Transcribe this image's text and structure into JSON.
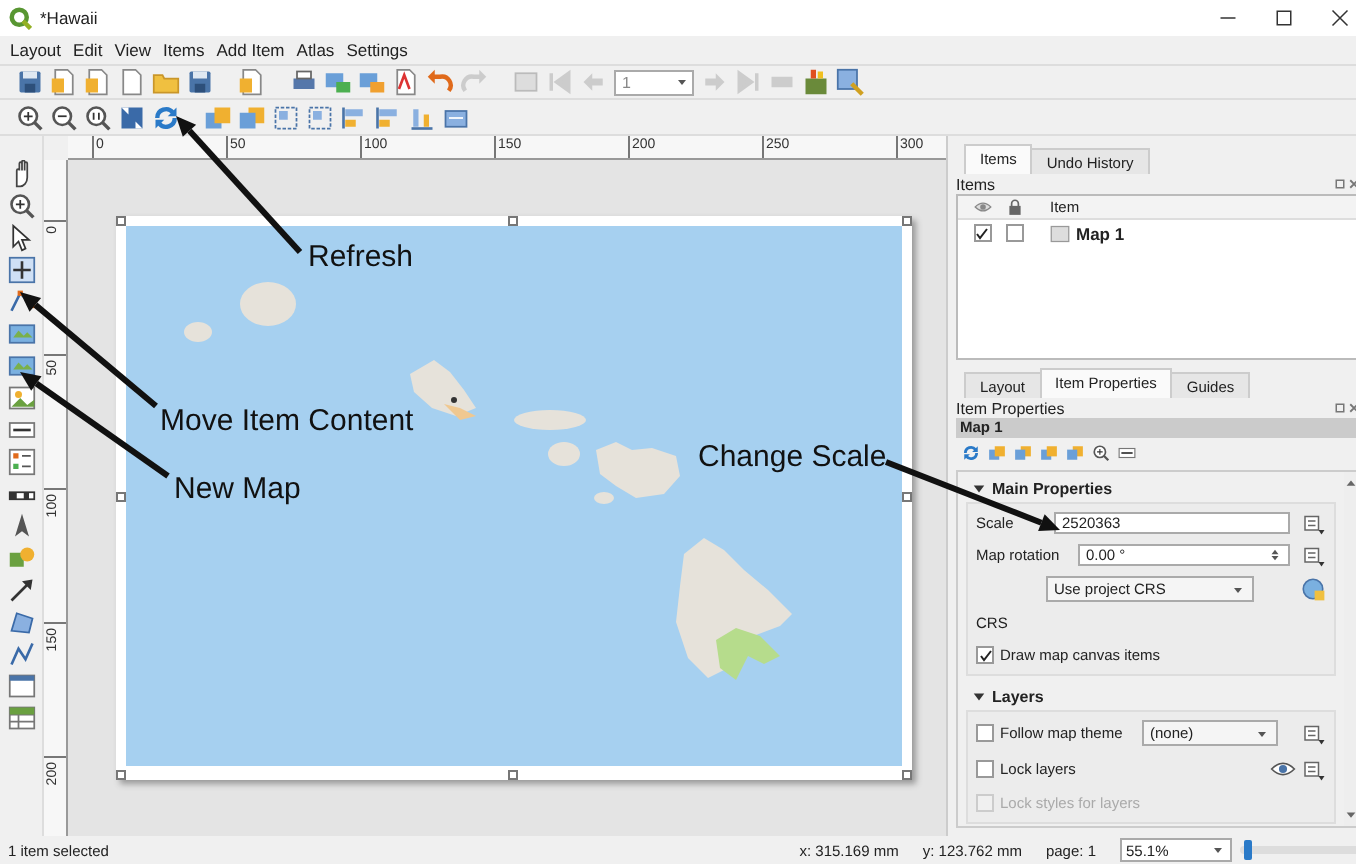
{
  "window": {
    "title": "*Hawaii"
  },
  "menu": [
    {
      "label": "Layout"
    },
    {
      "label": "Edit"
    },
    {
      "label": "View"
    },
    {
      "label": "Items"
    },
    {
      "label": "Add Item"
    },
    {
      "label": "Atlas"
    },
    {
      "label": "Settings"
    }
  ],
  "toolbar": {
    "page_field": "1"
  },
  "rulers": {
    "horizontal": [
      "0",
      "50",
      "100",
      "150",
      "200",
      "250",
      "300"
    ],
    "vertical": [
      "0",
      "50",
      "100",
      "150",
      "200"
    ]
  },
  "annotations": [
    {
      "text": "Refresh"
    },
    {
      "text": "Move Item Content"
    },
    {
      "text": "New Map"
    },
    {
      "text": "Change Scale"
    }
  ],
  "items_panel": {
    "tabs": [
      {
        "label": "Items",
        "selected": true
      },
      {
        "label": "Undo History",
        "selected": false
      }
    ],
    "title": "Items",
    "column": "Item",
    "items": [
      {
        "name": "Map 1",
        "visible": true,
        "locked": false
      }
    ]
  },
  "properties_panel": {
    "tabs": [
      {
        "label": "Layout",
        "selected": false
      },
      {
        "label": "Item Properties",
        "selected": true
      },
      {
        "label": "Guides",
        "selected": false
      }
    ],
    "title": "Item Properties",
    "item": "Map 1",
    "main": {
      "title": "Main Properties",
      "expanded": true,
      "scale_label": "Scale",
      "scale": "2520363",
      "rotation_label": "Map rotation",
      "rotation": "0.00 °",
      "crs_select": "Use project CRS",
      "crs_label": "CRS",
      "draw_canvas_items": {
        "label": "Draw map canvas items",
        "checked": true
      }
    },
    "layers": {
      "title": "Layers",
      "expanded": true,
      "follow_theme": {
        "label": "Follow map theme",
        "checked": false
      },
      "theme": "(none)",
      "lock_layers": {
        "label": "Lock layers",
        "checked": false
      },
      "lock_styles": {
        "label": "Lock styles for layers",
        "checked": false,
        "disabled": true
      }
    }
  },
  "status_bar": {
    "message": "1 item selected",
    "x": "x: 315.169 mm",
    "y": "y: 123.762 mm",
    "page": "page: 1",
    "zoom": "55.1%",
    "zoom_slider": {
      "level": 0.04
    }
  }
}
